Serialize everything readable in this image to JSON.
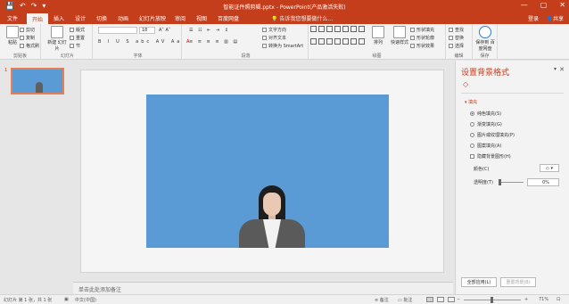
{
  "window": {
    "title": "智能证件照剪辑.pptx - PowerPoint(产品激活失败)",
    "qat": [
      "💾",
      "↶",
      "↷",
      "▾"
    ],
    "controls": [
      "—",
      "▢",
      "✕"
    ]
  },
  "tabs": [
    {
      "label": "文件",
      "active": false
    },
    {
      "label": "开始",
      "active": true
    },
    {
      "label": "插入",
      "active": false
    },
    {
      "label": "设计",
      "active": false
    },
    {
      "label": "切换",
      "active": false
    },
    {
      "label": "动画",
      "active": false
    },
    {
      "label": "幻灯片放映",
      "active": false
    },
    {
      "label": "审阅",
      "active": false
    },
    {
      "label": "视图",
      "active": false
    },
    {
      "label": "百度网盘",
      "active": false
    }
  ],
  "tell_me": "告诉我您想要做什么...",
  "account": {
    "login": "登录",
    "share": "共享"
  },
  "ribbon": {
    "clipboard": {
      "paste": "粘贴",
      "cut": "剪切",
      "copy": "复制",
      "format_painter": "格式刷",
      "label": "剪贴板"
    },
    "slides": {
      "new_slide": "新建\n幻灯片",
      "layout": "版式",
      "reset": "重置",
      "section": "节",
      "label": "幻灯片"
    },
    "font": {
      "size": "18",
      "label": "字体",
      "buttons": [
        "B",
        "I",
        "U",
        "S",
        "abc",
        "AV",
        "Aa",
        "A"
      ]
    },
    "paragraph": {
      "text_direction": "文字方向",
      "align_text": "对齐文本",
      "smartart": "转换为 SmartArt",
      "label": "段落"
    },
    "drawing": {
      "arrange": "排列",
      "quick_styles": "快速样式",
      "shape_fill": "形状填充",
      "shape_outline": "形状轮廓",
      "shape_effects": "形状效果",
      "label": "绘图"
    },
    "editing": {
      "find": "查找",
      "replace": "替换",
      "select": "选择",
      "label": "编辑"
    },
    "save": {
      "save_to": "保存到\n百度网盘",
      "label": "保存"
    }
  },
  "thumbnails": [
    {
      "number": "1"
    }
  ],
  "notes_placeholder": "单击此处添加备注",
  "format_pane": {
    "title": "设置背景格式",
    "section": "填充",
    "options": [
      {
        "label": "纯色填充(S)",
        "checked": true
      },
      {
        "label": "渐变填充(G)",
        "checked": false
      },
      {
        "label": "图片或纹理填充(P)",
        "checked": false
      },
      {
        "label": "图案填充(A)",
        "checked": false
      }
    ],
    "hide_background": "隐藏背景图形(H)",
    "color_label": "颜色(C)",
    "transparency_label": "透明度(T)",
    "transparency_value": "0%",
    "apply_all": "全部应用(L)",
    "reset_background": "重置背景(B)",
    "accent": "#c43e1c",
    "slide_bg": "#5b9bd5"
  },
  "status": {
    "slide_info": "幻灯片 第 1 张，共 1 张",
    "language": "中文(中国)",
    "notes": "备注",
    "comments": "批注",
    "zoom": "71%"
  }
}
